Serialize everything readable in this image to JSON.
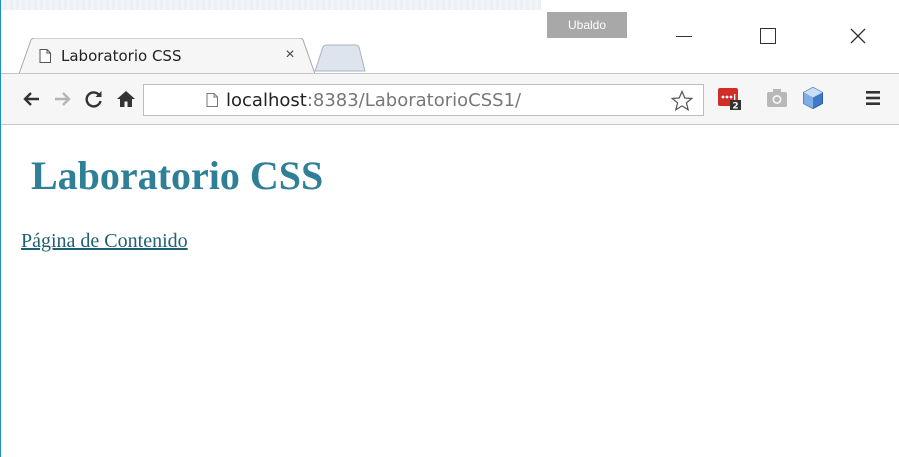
{
  "window": {
    "user_name": "Ubaldo"
  },
  "tab": {
    "title": "Laboratorio CSS",
    "close_glyph": "×"
  },
  "toolbar": {
    "url_host": "localhost",
    "url_rest": ":8383/LaboratorioCSS1/",
    "icons": [
      "back-icon",
      "forward-icon",
      "reload-icon",
      "home-icon",
      "star-icon",
      "lastpass-icon",
      "camera-icon",
      "cube-icon",
      "menu-icon"
    ],
    "lastpass_badge": "2"
  },
  "page": {
    "heading": "Laboratorio CSS",
    "link_text": "Página de Contenido"
  },
  "colors": {
    "heading": "#2f7f97",
    "link": "#1f5f73",
    "window_border": "#1e8fc6",
    "lastpass_red": "#d32d27"
  }
}
